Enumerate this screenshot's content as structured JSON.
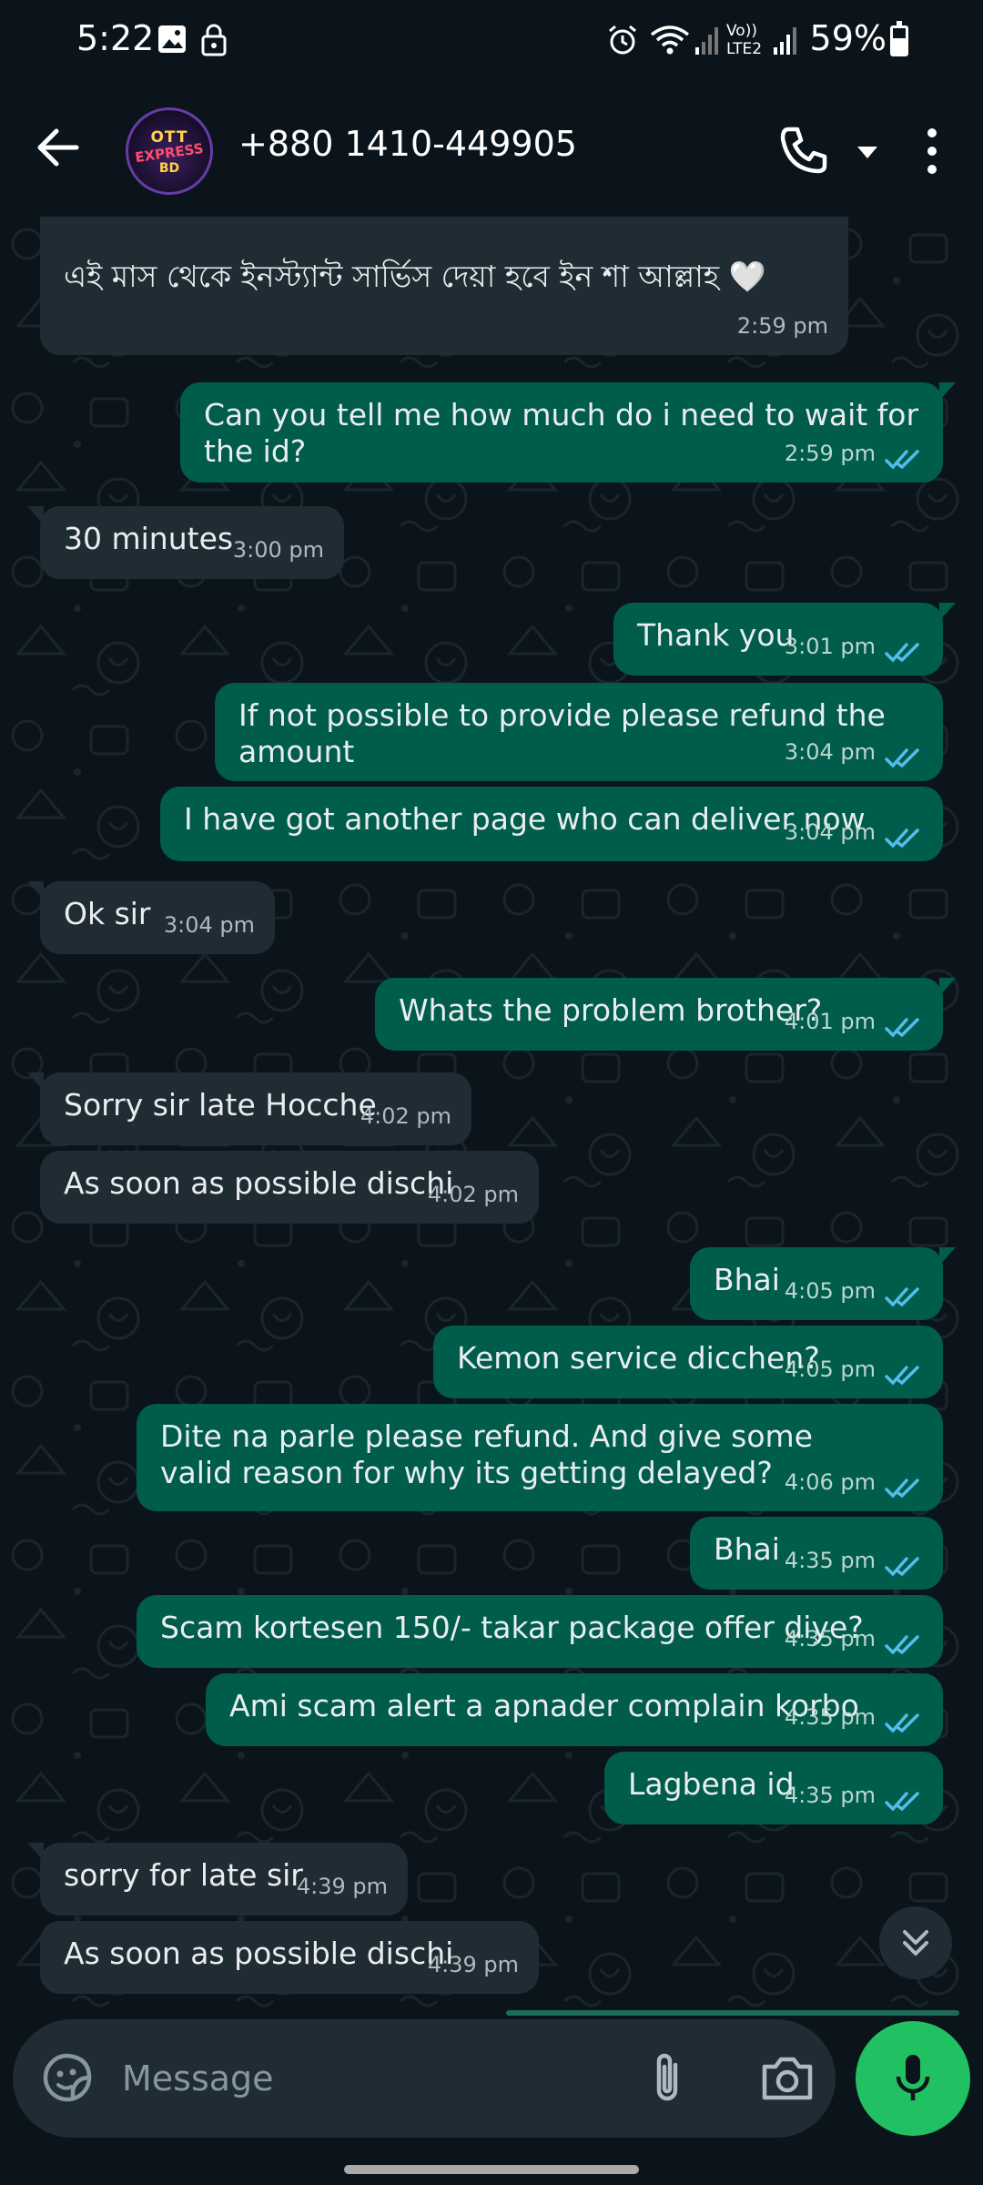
{
  "status_bar": {
    "time": "5:22",
    "battery": "59%",
    "network_label": "Vo)) LTE2",
    "icons": [
      "image-icon",
      "lock-icon",
      "alarm-icon",
      "wifi-icon",
      "signal-icon",
      "signal-icon-2",
      "battery-icon"
    ]
  },
  "header": {
    "contact": "+880 1410-449905",
    "avatar_text": {
      "top": "OTT",
      "middle": "EXPRESS",
      "bottom": "BD"
    },
    "icons": [
      "back-arrow-icon",
      "phone-icon",
      "chevron-down-icon",
      "more-vert-icon"
    ]
  },
  "messages": [
    {
      "dir": "in",
      "text": "এই মাস থেকে ইনস্ট্যান্ট সার্ভিস দেয়া হবে ইন শা আল্লাহ 🤍",
      "time": "2:59 pm"
    },
    {
      "dir": "out",
      "text": "Can you tell me how much do i need to wait for the id?",
      "time": "2:59 pm",
      "read": true
    },
    {
      "dir": "in",
      "text": "30 minutes",
      "time": "3:00 pm"
    },
    {
      "dir": "out",
      "text": "Thank you",
      "time": "3:01 pm",
      "read": true
    },
    {
      "dir": "out",
      "text": "If not possible to provide please refund the amount",
      "time": "3:04 pm",
      "read": true
    },
    {
      "dir": "out",
      "text": "I have got another page who can deliver now",
      "time": "3:04 pm",
      "read": true
    },
    {
      "dir": "in",
      "text": "Ok sir",
      "time": "3:04 pm"
    },
    {
      "dir": "out",
      "text": "Whats the problem brother?",
      "time": "4:01 pm",
      "read": true
    },
    {
      "dir": "in",
      "text": "Sorry sir late Hocche",
      "time": "4:02 pm"
    },
    {
      "dir": "in",
      "text": "As soon as possible dischi",
      "time": "4:02 pm"
    },
    {
      "dir": "out",
      "text": "Bhai",
      "time": "4:05 pm",
      "read": true
    },
    {
      "dir": "out",
      "text": "Kemon service dicchen?",
      "time": "4:05 pm",
      "read": true
    },
    {
      "dir": "out",
      "text": "Dite na parle please refund. And give some valid reason for why its getting delayed?",
      "time": "4:06 pm",
      "read": true
    },
    {
      "dir": "out",
      "text": "Bhai",
      "time": "4:35 pm",
      "read": true
    },
    {
      "dir": "out",
      "text": "Scam kortesen 150/- takar package offer diye?",
      "time": "4:35 pm",
      "read": true
    },
    {
      "dir": "out",
      "text": "Ami scam alert a apnader complain korbo",
      "time": "4:35 pm",
      "read": true
    },
    {
      "dir": "out",
      "text": "Lagbena id",
      "time": "4:35 pm",
      "read": true
    },
    {
      "dir": "in",
      "text": "sorry for late sir",
      "time": "4:39 pm"
    },
    {
      "dir": "in",
      "text": "As soon as possible dischi",
      "time": "4:39 pm"
    }
  ],
  "composer": {
    "placeholder": "Message",
    "value": "",
    "icons": [
      "sticker-emoji-icon",
      "attach-paperclip-icon",
      "camera-icon",
      "mic-icon"
    ]
  },
  "colors": {
    "background": "#0b141a",
    "incoming_bubble": "#202c33",
    "outgoing_bubble": "#005c4b",
    "read_ticks": "#53bdeb",
    "accent_green": "#21c063"
  }
}
